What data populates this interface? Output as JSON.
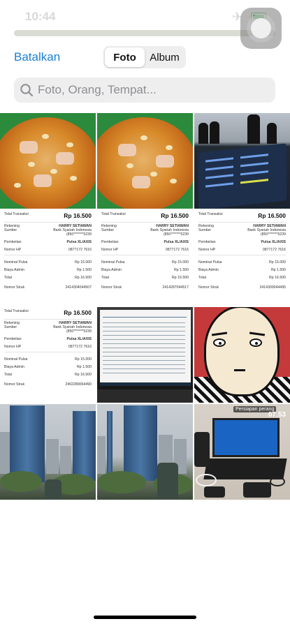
{
  "status": {
    "time": "10:44"
  },
  "header": {
    "cancel_label": "Batalkan",
    "tabs": [
      {
        "label": "Foto",
        "active": true
      },
      {
        "label": "Album",
        "active": false
      }
    ]
  },
  "search": {
    "placeholder": "Foto, Orang, Tempat..."
  },
  "colors": {
    "accent": "#1a7fd4",
    "segment_bg": "#eeeeef"
  },
  "receipts": [
    {
      "total_label": "Total Transaksi",
      "total_value": "Rp 16.500",
      "rekening_label": "Rekening",
      "rekening_value": "HARRY SETIAWAN",
      "sumber_label": "Sumber",
      "sumber_value": "Bank Syariah Indonesia",
      "sumber_account": "(850*******5239",
      "pembelian_label": "Pembelian",
      "pembelian_value": "Pulsa XL/AXIS",
      "nomor_hp_label": "Nomor HP",
      "nomor_hp_value": "0877172 7616",
      "nominal_label": "Nominal Pulsa",
      "nominal_value": "Rp 15.000",
      "admin_label": "Biaya Admin",
      "admin_value": "Rp 1.500",
      "total2_label": "Total",
      "total2_value": "Rp 16.500",
      "struk_label": "Nomor Struk",
      "struk_value": "2414304044507"
    },
    {
      "total_label": "Total Transaksi",
      "total_value": "Rp 16.500",
      "rekening_label": "Rekening",
      "rekening_value": "HARRY SETIAWAN",
      "sumber_label": "Sumber",
      "sumber_value": "Bank Syariah Indonesia",
      "sumber_account": "(850*******5239",
      "pembelian_label": "Pembelian",
      "pembelian_value": "Pulsa XL/AXIS",
      "nomor_hp_label": "Nomor HP",
      "nomor_hp_value": "0877172 7616",
      "nominal_label": "Nominal Pulsa",
      "nominal_value": "Rp 15.000",
      "admin_label": "Biaya Admin",
      "admin_value": "Rp 1.500",
      "total2_label": "Total",
      "total2_value": "Rp 16.500",
      "struk_label": "Nomor Struk",
      "struk_value": "2414287044517"
    },
    {
      "total_label": "Total Transaksi",
      "total_value": "Rp 16.500",
      "rekening_label": "Rekening",
      "rekening_value": "HARRY SETIAWAN",
      "sumber_label": "Sumber",
      "sumber_value": "Bank Syariah Indonesia",
      "sumber_account": "(850*******5239",
      "pembelian_label": "Pembelian",
      "pembelian_value": "Pulsa XL/AXIS",
      "nomor_hp_label": "Nomor HP",
      "nomor_hp_value": "0877172 7616",
      "nominal_label": "Nominal Pulsa",
      "nominal_value": "Rp 15.000",
      "admin_label": "Biaya Admin",
      "admin_value": "Rp 1.500",
      "total2_label": "Total",
      "total2_value": "Rp 16.500",
      "struk_label": "Nomor Struk",
      "struk_value": "2414300044495"
    },
    {
      "total_label": "Total Transaksi",
      "total_value": "Rp 16.500",
      "rekening_label": "Rekening",
      "rekening_value": "HARRY SETIAWAN",
      "sumber_label": "Sumber",
      "sumber_value": "Bank Syariah Indonesia",
      "sumber_account": "(850*******5239",
      "pembelian_label": "Pembelian",
      "pembelian_value": "Pulsa XL/AXIS",
      "nomor_hp_label": "Nomor HP",
      "nomor_hp_value": "0877172 7616",
      "nominal_label": "Nominal Pulsa",
      "nominal_value": "Rp 15.000",
      "admin_label": "Biaya Admin",
      "admin_value": "Rp 1.500",
      "total2_label": "Total",
      "total2_value": "Rp 16.500",
      "struk_label": "Nomor Struk",
      "struk_value": "2402289064490"
    }
  ],
  "desk_photo": {
    "caption": "Persiapan perang",
    "clock": "07.53"
  }
}
